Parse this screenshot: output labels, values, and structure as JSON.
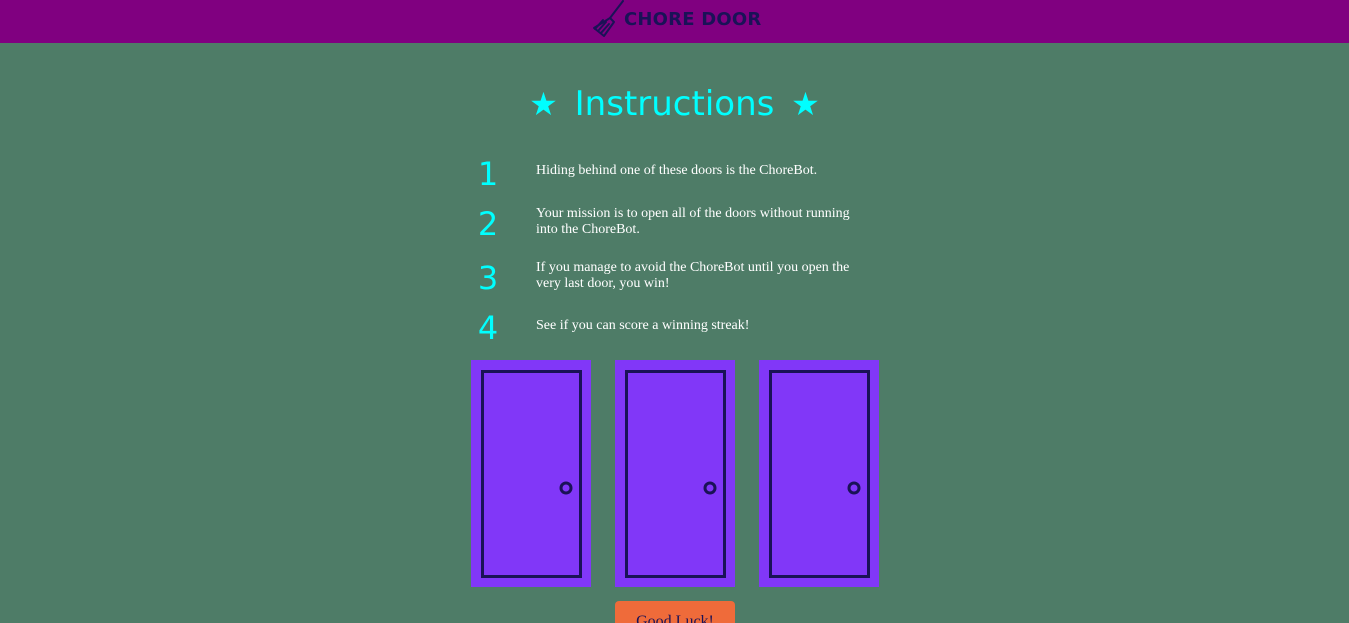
{
  "header": {
    "logo_text": "CHORE DOOR",
    "logo_icon": "broom-icon",
    "background": "#800080"
  },
  "instructions": {
    "star_left": "★",
    "title": "Instructions",
    "star_right": "★",
    "steps": [
      {
        "number": "1",
        "text": "Hiding behind one of these doors is the ChoreBot."
      },
      {
        "number": "2",
        "text": "Your mission is to open all of the doors without running into the ChoreBot."
      },
      {
        "number": "3",
        "text": "If you manage to avoid the ChoreBot until you open the very last door, you win!"
      },
      {
        "number": "4",
        "text": "See if you can score a winning streak!"
      }
    ]
  },
  "doors": {
    "count": 3,
    "color": "#8137f8",
    "outline_color": "#1a1257",
    "icon": "door-icon"
  },
  "start_button": {
    "label": "Good Luck!",
    "color": "#ef6b3a"
  },
  "colors": {
    "background": "#4e7c67",
    "accent": "#00ffff"
  }
}
